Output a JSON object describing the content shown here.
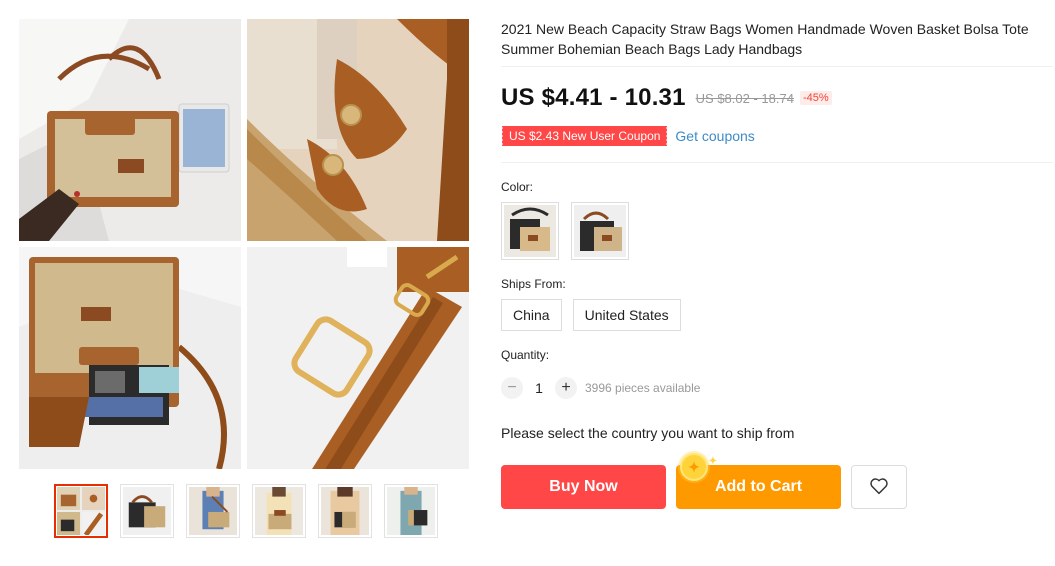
{
  "product": {
    "title": "2021 New Beach Capacity Straw Bags Women Handmade Woven Basket Bolsa Tote Summer Bohemian Beach Bags Lady Handbags",
    "price": "US $4.41 - 10.31",
    "original_price": "US $8.02 - 18.74",
    "discount": "-45%"
  },
  "coupon": {
    "label": "US $2.43 New User Coupon",
    "link": "Get coupons"
  },
  "color": {
    "label": "Color:"
  },
  "ships_from": {
    "label": "Ships From:",
    "options": [
      "China",
      "United States"
    ]
  },
  "quantity": {
    "label": "Quantity:",
    "value": "1",
    "minus": "−",
    "plus": "+",
    "available": "3996 pieces available"
  },
  "ship_note": "Please select the country you want to ship from",
  "actions": {
    "buy_now": "Buy Now",
    "add_to_cart": "Add to Cart",
    "wishlist_icon": "heart-icon",
    "coin_icon": "coin-icon"
  },
  "colors": {
    "buy_now": "#ff4747",
    "add_to_cart": "#ff9900",
    "coupon": "#ff4747",
    "link": "#3d8bc7",
    "thumb_active": "#e62e04"
  }
}
